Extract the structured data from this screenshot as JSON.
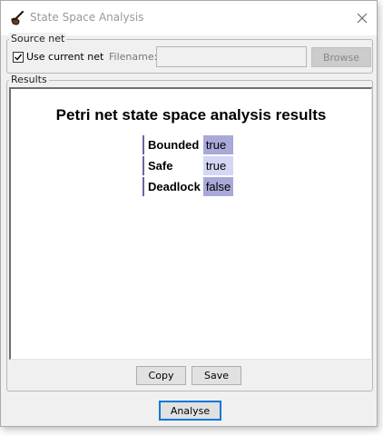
{
  "window": {
    "title": "State Space Analysis"
  },
  "source_net": {
    "legend": "Source net",
    "use_current_net_label": "Use current net",
    "use_current_net_checked": true,
    "filename_label": "Filename:",
    "filename_value": "",
    "browse_label": "Browse"
  },
  "results": {
    "legend": "Results",
    "heading": "Petri net state space analysis results",
    "rows": [
      {
        "label": "Bounded",
        "value": "true"
      },
      {
        "label": "Safe",
        "value": "true"
      },
      {
        "label": "Deadlock",
        "value": "false"
      }
    ],
    "copy_label": "Copy",
    "save_label": "Save"
  },
  "footer": {
    "analyse_label": "Analyse"
  },
  "colors": {
    "value_dark": "#a9a9d9",
    "value_light": "#d5d5f5",
    "accent": "#0078d7"
  }
}
